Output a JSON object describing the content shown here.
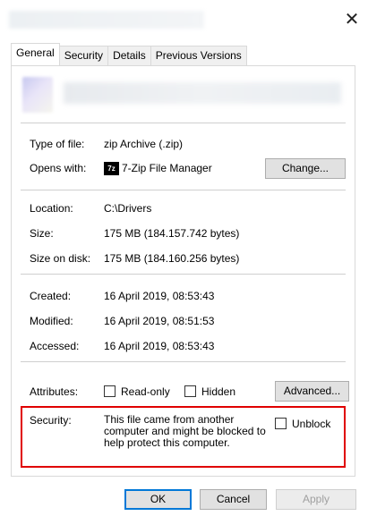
{
  "window": {
    "close_glyph": "✕"
  },
  "tabs": [
    {
      "label": "General",
      "active": true
    },
    {
      "label": "Security",
      "active": false
    },
    {
      "label": "Details",
      "active": false
    },
    {
      "label": "Previous Versions",
      "active": false
    }
  ],
  "file_info": {
    "type_label": "Type of file:",
    "type_value": "zip Archive (.zip)",
    "opens_label": "Opens with:",
    "opens_icon_text": "7z",
    "opens_value": "7-Zip File Manager",
    "change_button": "Change..."
  },
  "location": {
    "location_label": "Location:",
    "location_value": "C:\\Drivers",
    "size_label": "Size:",
    "size_value": "175 MB (184.157.742 bytes)",
    "size_on_disk_label": "Size on disk:",
    "size_on_disk_value": "175 MB (184.160.256 bytes)"
  },
  "dates": {
    "created_label": "Created:",
    "created_value": "16 April 2019, 08:53:43",
    "modified_label": "Modified:",
    "modified_value": "16 April 2019, 08:51:53",
    "accessed_label": "Accessed:",
    "accessed_value": "16 April 2019, 08:53:43"
  },
  "attributes": {
    "label": "Attributes:",
    "readonly_label": "Read-only",
    "hidden_label": "Hidden",
    "advanced_button": "Advanced..."
  },
  "security": {
    "label": "Security:",
    "line1": "This file came from another",
    "line2": "computer and might be blocked to",
    "line3": "help protect this computer.",
    "unblock_label": "Unblock"
  },
  "footer": {
    "ok": "OK",
    "cancel": "Cancel",
    "apply": "Apply"
  },
  "colors": {
    "highlight_border": "#e00000",
    "ok_border": "#0078d7"
  }
}
